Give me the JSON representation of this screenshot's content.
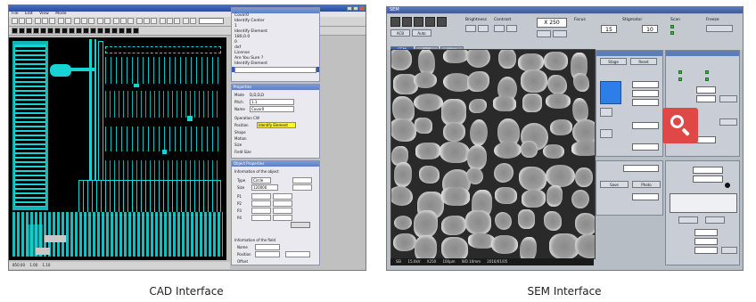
{
  "captions": {
    "cad": "CAD Interface",
    "sem": "SEM Interface"
  },
  "cad": {
    "menu": [
      "File",
      "Edit",
      "View",
      "Mode"
    ],
    "layer_select": "",
    "status": [
      "850.00",
      "1.00",
      "1.10"
    ],
    "list_panel": {
      "items": [
        "Cover0",
        "Identify Center",
        "1",
        "Identify Element",
        "180,0.0",
        "0",
        "dxf",
        "License",
        "Are You Sure ?",
        "Identify Element",
        "Identify Element"
      ],
      "selected_index": 10
    },
    "property_panel": {
      "title": "Properties",
      "fields": [
        {
          "label": "Mode",
          "value": "D,D,D,D"
        },
        {
          "label": "Pitch",
          "value": "1.1"
        },
        {
          "label": "Name",
          "value": "Cover0"
        }
      ],
      "highlight_value": "Identify Element",
      "lines": [
        "Operation  CW",
        "Position",
        "Shape",
        "Motion",
        "Size",
        "Field Size"
      ]
    },
    "object_panel": {
      "title": "Object Properties",
      "subtitle": "Information of the object",
      "type_value": "Circle",
      "size_value": "120000",
      "rows": [
        "P1",
        "P2",
        "P3",
        "P4"
      ],
      "bottom_subtitle": "Information of the field",
      "bottom_rows": [
        "Name",
        "Position",
        "Offset"
      ]
    }
  },
  "sem": {
    "title": "SEM",
    "tabs": [
      "SEM",
      "EDS",
      "View"
    ],
    "magnification": "X 250",
    "accel_value": "15",
    "wd_value": "10",
    "infobar": [
      "SEI",
      "15.0kV",
      "X250",
      "100μm",
      "WD 10mm",
      "2016/01/05"
    ],
    "right_panel_title": "",
    "labels": [
      "Brightness",
      "Contrast",
      "Focus",
      "Stigmator",
      "Scan",
      "Freeze"
    ],
    "buttons": [
      "ACB",
      "Auto",
      "Save",
      "Photo",
      "Stage",
      "Reset"
    ],
    "zoom_icon": "magnifier-icon",
    "colors": {
      "accent": "#3b66b8",
      "zoom": "#e04848",
      "preview": "#2d7ee6"
    }
  }
}
